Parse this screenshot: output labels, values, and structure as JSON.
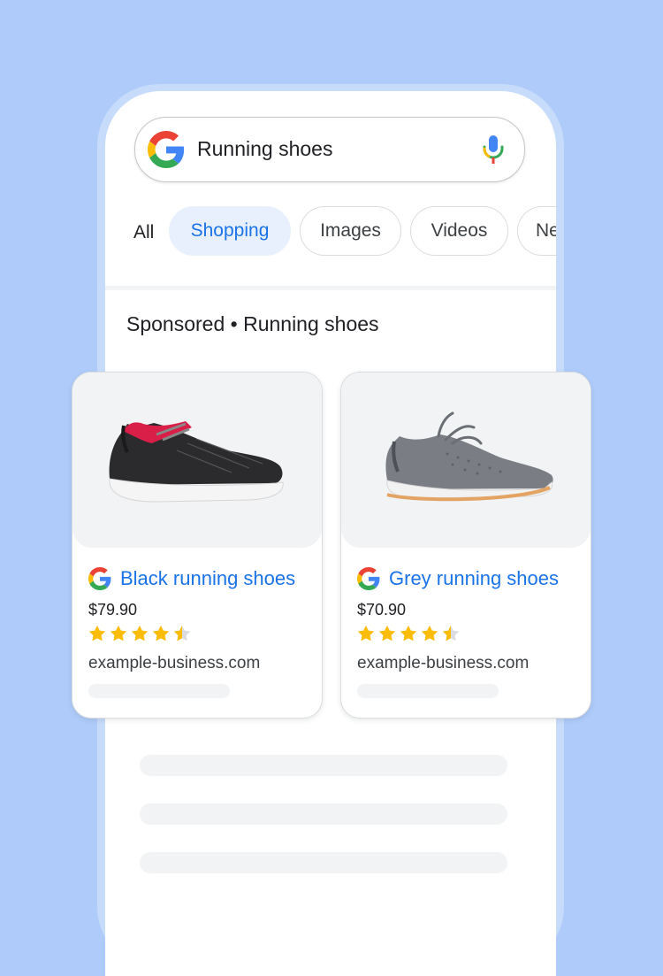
{
  "search": {
    "query": "Running shoes"
  },
  "tabs": {
    "all_label": "All",
    "chips": [
      "Shopping",
      "Images",
      "Videos",
      "News"
    ]
  },
  "section": {
    "heading": "Sponsored • Running shoes"
  },
  "products": [
    {
      "title": "Black running shoes",
      "price": "$79.90",
      "rating": 4.5,
      "domain": "example-business.com"
    },
    {
      "title": "Grey running shoes",
      "price": "$70.90",
      "rating": 4.5,
      "domain": "example-business.com"
    }
  ],
  "colors": {
    "background": "#aecbfa",
    "link_blue": "#1a73e8",
    "active_chip_bg": "#e8f0fe",
    "star_yellow": "#fbbc04",
    "skeleton": "#f1f3f4"
  },
  "icons": [
    "google-logo-icon",
    "microphone-icon",
    "star-icon",
    "half-star-icon"
  ]
}
